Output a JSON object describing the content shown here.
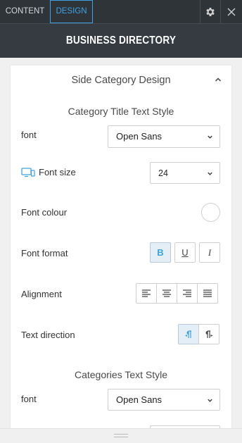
{
  "tabs": [
    {
      "label": "CONTENT",
      "active": false
    },
    {
      "label": "DESIGN",
      "active": true
    }
  ],
  "header": {
    "title": "BUSINESS DIRECTORY"
  },
  "panel": {
    "title": "Side Category Design",
    "category_title_style": {
      "heading": "Category Title Text Style",
      "font_label": "font",
      "font_value": "Open Sans",
      "font_size_label": "Font size",
      "font_size_value": "24",
      "font_colour_label": "Font colour",
      "font_colour_value": "#ffffff",
      "font_format_label": "Font format",
      "font_format_buttons": [
        {
          "label": "B",
          "name": "bold",
          "active": true
        },
        {
          "label": "U",
          "name": "underline",
          "active": false
        },
        {
          "label": "I",
          "name": "italic",
          "active": false
        }
      ],
      "alignment_label": "Alignment",
      "alignment_options": [
        "align-left",
        "align-center",
        "align-right",
        "align-justify"
      ],
      "text_direction_label": "Text direction",
      "text_direction_options": [
        {
          "name": "rtl",
          "active": true
        },
        {
          "name": "ltr",
          "active": false
        }
      ]
    },
    "categories_text_style": {
      "heading": "Categories Text Style",
      "font_label": "font",
      "font_value": "Open Sans"
    }
  },
  "colors": {
    "accent": "#3ea2e5",
    "topbar": "#2f3438",
    "header": "#353b40",
    "active_button_bg": "#e3eef7"
  },
  "icons": {
    "settings": "gear-icon",
    "close": "close-icon",
    "collapse": "chevron-up-icon",
    "responsive": "desktop-mobile-icon",
    "dropdown": "chevron-down-icon",
    "resize": "drag-handle-icon"
  }
}
